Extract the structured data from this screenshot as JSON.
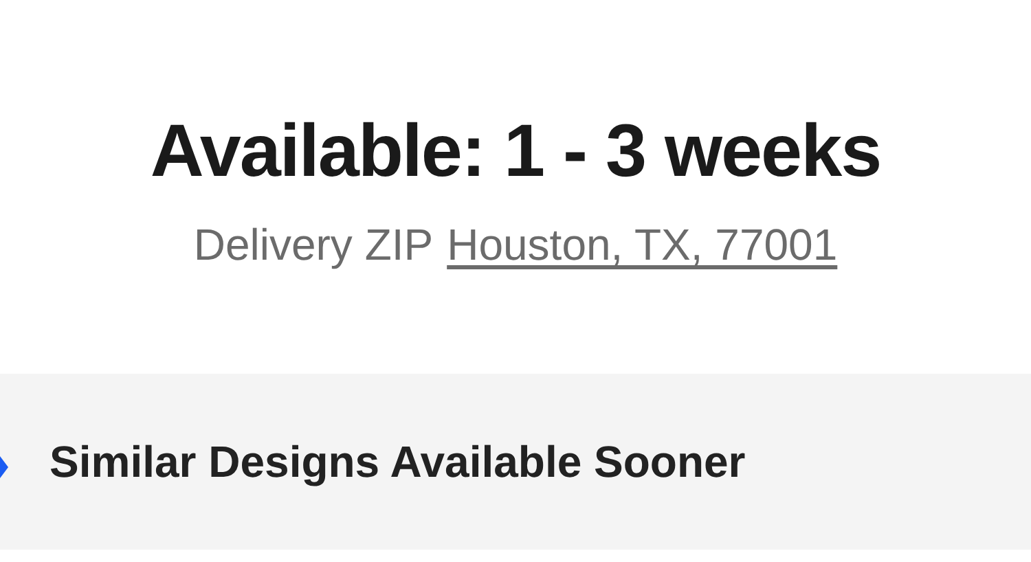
{
  "availability": {
    "title": "Available: 1 - 3 weeks",
    "zip_label": "Delivery ZIP",
    "zip_link": "Houston, TX, 77001"
  },
  "banner": {
    "label": "Similar Designs Available Sooner"
  }
}
